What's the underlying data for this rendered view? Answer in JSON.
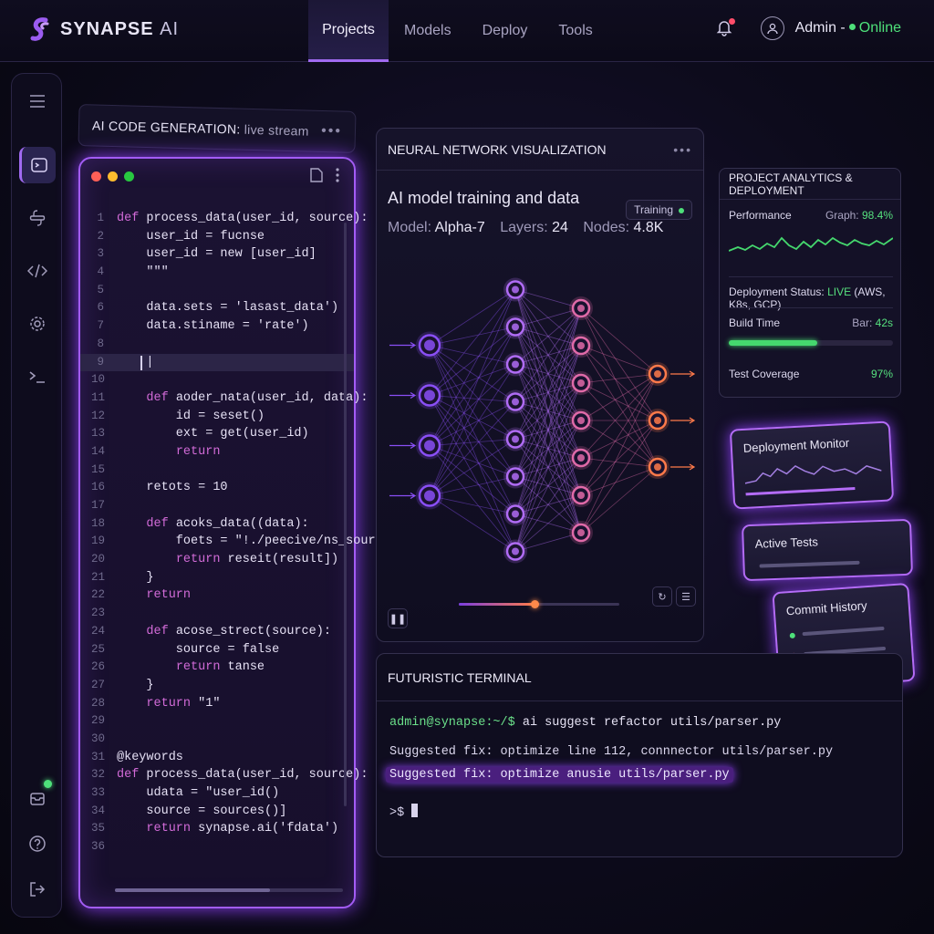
{
  "topbar": {
    "logo_bold": "SYNAPSE",
    "logo_light": "AI",
    "nav": [
      "Projects",
      "Models",
      "Deploy",
      "Tools"
    ],
    "active_tab": "Projects",
    "user_name": "Admin",
    "separator": "-",
    "status": "Online"
  },
  "colors": {
    "accent": "#a06af0",
    "online": "#4ee07a",
    "alert": "#ff4d6a",
    "success": "#56e07e"
  },
  "sidebar": {
    "icons": [
      "menu-icon",
      "terminal-icon",
      "python-icon",
      "code-icon",
      "settings-icon",
      "console-icon",
      "notification-icon",
      "help-icon",
      "logout-icon"
    ],
    "active": "terminal-icon"
  },
  "code_panel": {
    "title": "AI CODE GENERATION:",
    "subtitle": "live stream",
    "menu": "•••",
    "lines": [
      "def process_data(user_id, source):",
      "    user_id = fucnse",
      "    user_id = new [user_id]",
      "    \"\"\"",
      "",
      "    data.sets = 'lasast_data')",
      "    data.stiname = 'rate')",
      "",
      "    |",
      "",
      "    def aoder_nata(user_id, data):",
      "        id = seset()",
      "        ext = get(user_id)",
      "        return",
      "",
      "    retots = 10",
      "",
      "    def acoks_data((data):",
      "        foets = \"!./peecive/ns_source\")",
      "        return reseit(result])",
      "    }",
      "    return",
      "",
      "    def acose_strect(source):",
      "        source = false",
      "        return tanse",
      "    }",
      "    return \"1\"",
      "",
      "",
      "@keywords",
      "def process_data(user_id, source):",
      "    udata = \"user_id()",
      "    source = sources()]",
      "    return synapse.ai('fdata')",
      ""
    ]
  },
  "nn_panel": {
    "title": "NEURAL NETWORK VISUALIZATION",
    "menu": "•••",
    "subtitle": "AI model training and data",
    "model_label": "Model:",
    "model": "Alpha-7",
    "layers_label": "Layers:",
    "layers": "24",
    "nodes_label": "Nodes:",
    "nodes": "4.8K",
    "badge": "Training",
    "progress": 0.47,
    "network": [
      4,
      8,
      7,
      3
    ]
  },
  "analytics": {
    "title": "PROJECT ANALYTICS & DEPLOYMENT",
    "performance_label": "Performance",
    "graph_label": "Graph:",
    "graph_value": "98.4%",
    "deploy_label": "Deployment Status:",
    "deploy_status": "LIVE",
    "deploy_targets": "(AWS, K8s, GCP)",
    "build_label": "Build Time",
    "bar_label": "Bar:",
    "build_time": "42s",
    "build_progress": 0.54,
    "coverage_label": "Test Coverage",
    "coverage": "97%"
  },
  "cards": {
    "deployment": "Deployment Monitor",
    "tests": "Active Tests",
    "commits": "Commit History"
  },
  "terminal": {
    "title": "FUTURISTIC TERMINAL",
    "prompt": "admin@synapse:~/$",
    "command": "ai suggest refactor utils/parser.py",
    "line1": "Suggested fix: optimize line 112, connnector utils/parser.py",
    "line2": "Suggested fix: optimize anusie utils/parser.py",
    "input_prompt": ">$"
  }
}
